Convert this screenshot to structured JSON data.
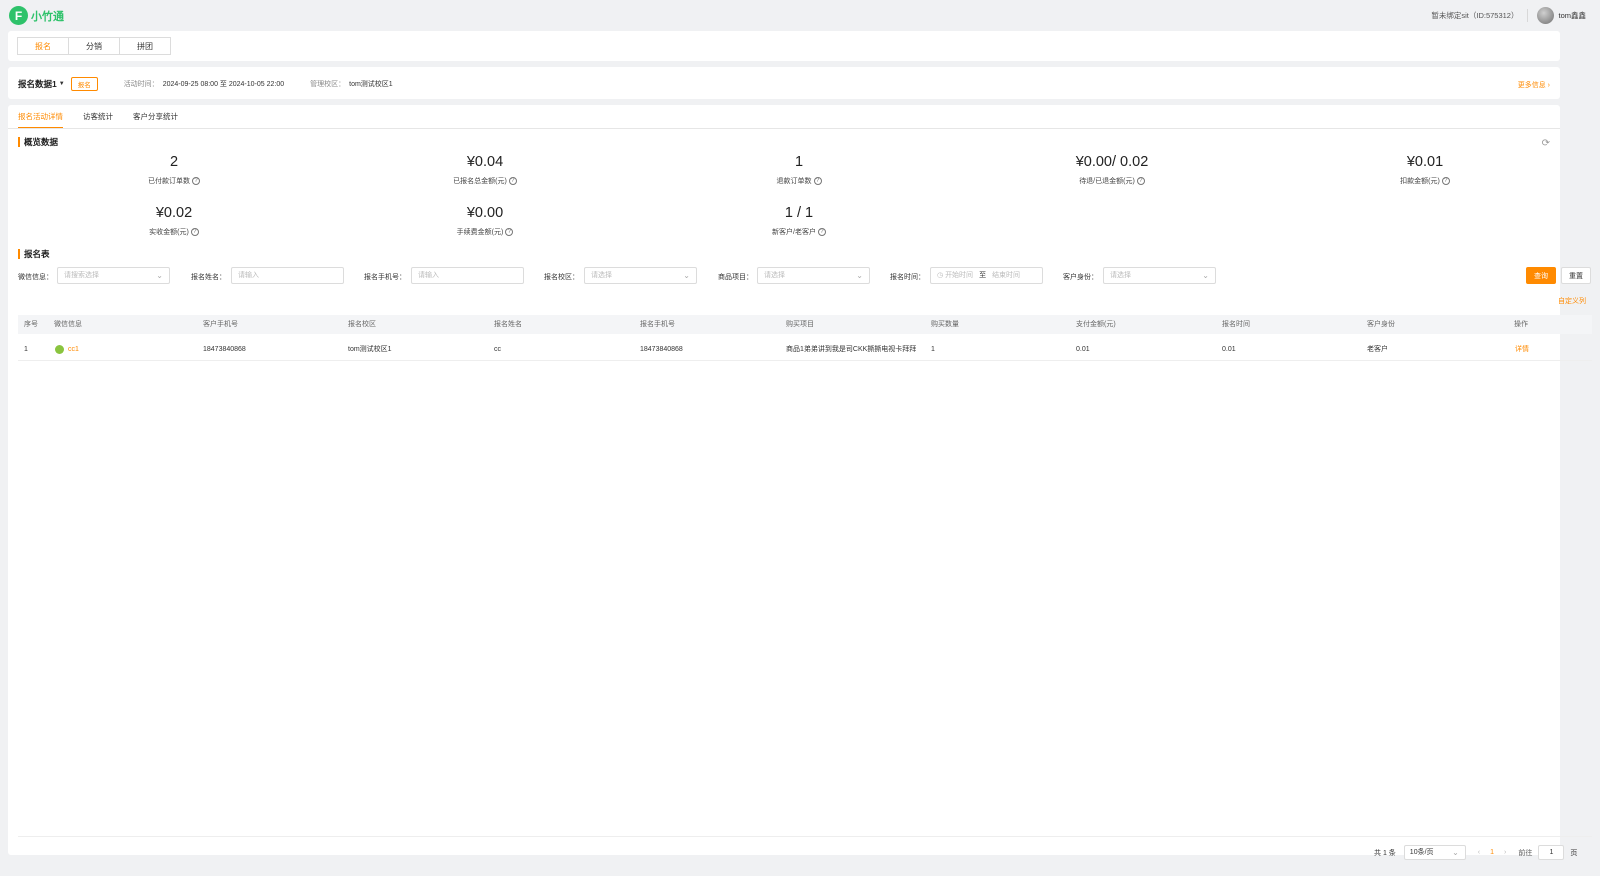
{
  "app": {
    "logo_char": "F",
    "logo_text": "小竹通",
    "bind_status": "暂未绑定sit（ID:575312）",
    "username": "tom鑫鑫"
  },
  "modules": {
    "tabs": [
      "报名",
      "分销",
      "拼团"
    ]
  },
  "activity": {
    "name": "报名数据1",
    "tag": "报名",
    "time_label": "活动时间：",
    "time_value": "2024-09-25 08:00 至 2024-10-05 22:00",
    "school_label": "管理校区：",
    "school_value": "tom测试校区1",
    "more": "更多信息 ›"
  },
  "tabs": [
    "报名活动详情",
    "访客统计",
    "客户分享统计"
  ],
  "overview": {
    "title": "概览数据",
    "stats": [
      {
        "value": "2",
        "label": "已付款订单数"
      },
      {
        "value": "¥0.04",
        "label": "已报名总金额(元)"
      },
      {
        "value": "1",
        "label": "退款订单数"
      },
      {
        "value": "¥0.00/ 0.02",
        "label": "待退/已退金额(元)"
      },
      {
        "value": "¥0.01",
        "label": "扣款金额(元)"
      },
      {
        "value": "¥0.02",
        "label": "实收金额(元)"
      },
      {
        "value": "¥0.00",
        "label": "手续费金额(元)"
      },
      {
        "value": "1 / 1",
        "label": "新客户/老客户"
      }
    ]
  },
  "table_section": {
    "title": "报名表"
  },
  "filters": {
    "wechat": {
      "label": "微信信息：",
      "placeholder": "请搜索选择"
    },
    "name": {
      "label": "报名姓名：",
      "placeholder": "请输入"
    },
    "phone": {
      "label": "报名手机号：",
      "placeholder": "请输入"
    },
    "school": {
      "label": "报名校区：",
      "placeholder": "请选择"
    },
    "item": {
      "label": "商品项目：",
      "placeholder": "请选择"
    },
    "time": {
      "label": "报名时间：",
      "start": "开始时间",
      "sep": "至",
      "end": "结束时间"
    },
    "identity": {
      "label": "客户身份：",
      "placeholder": "请选择"
    },
    "query": "查询",
    "reset": "重置",
    "custom_columns": "自定义列"
  },
  "table": {
    "columns": [
      "序号",
      "微信信息",
      "客户手机号",
      "报名校区",
      "报名姓名",
      "报名手机号",
      "购买项目",
      "购买数量",
      "支付金额(元)",
      "报名时间",
      "客户身份",
      "操作"
    ],
    "rows": [
      {
        "index": "1",
        "wechat": "cc1",
        "customer_phone": "18473840868",
        "school": "tom测试校区1",
        "name": "cc",
        "phone": "18473840868",
        "item": "商品1弟弟讲到我是司CKK撕撕电视卡拜拜",
        "qty": "1",
        "amount": "0.01",
        "time": "0.01",
        "identity": "老客户",
        "action": "详情"
      }
    ]
  },
  "pagination": {
    "total": "共 1 条",
    "page_size": "10条/页",
    "current": "1",
    "goto_label": "前往",
    "goto_value": "1",
    "unit": "页"
  }
}
